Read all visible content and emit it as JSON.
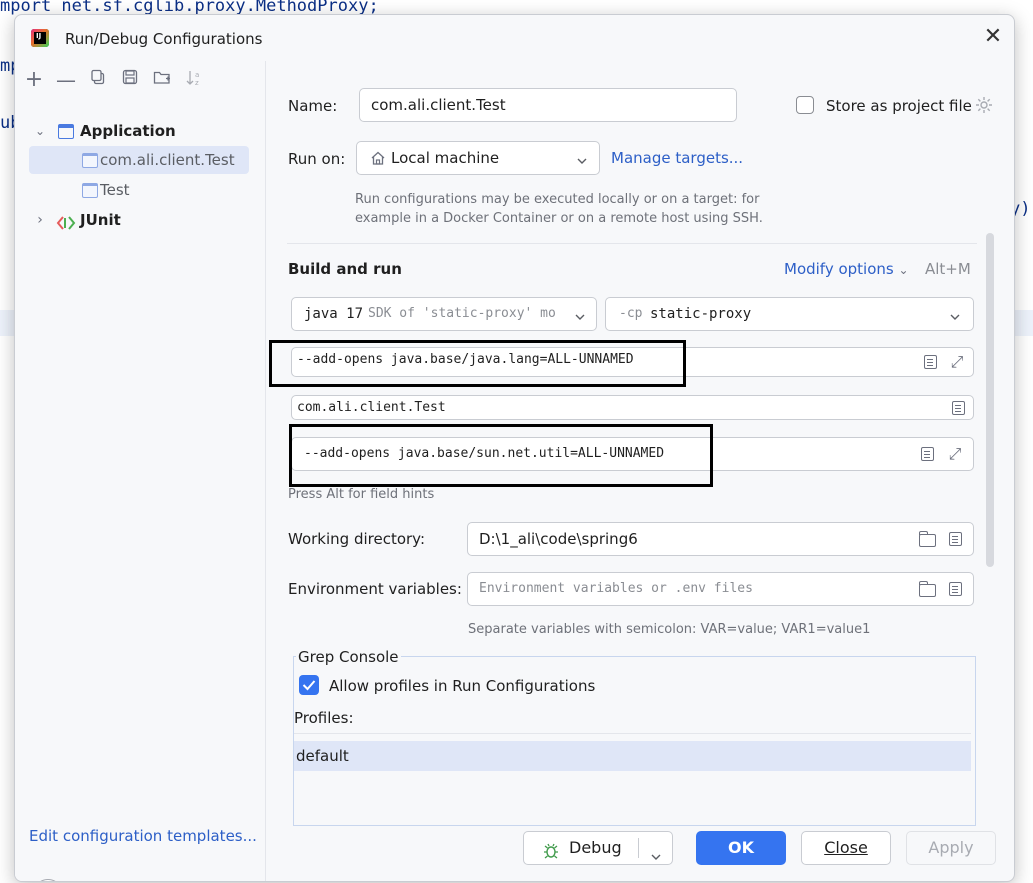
{
  "editor": {
    "line1": "mport net.sf.cglib.proxy.MethodProxy;",
    "frag2": "mp",
    "frag3": "ub",
    "frag4": "y)"
  },
  "dialog": {
    "title": "Run/Debug Configurations",
    "close_icon": "close-icon"
  },
  "tree": {
    "application_label": "Application",
    "config_selected": "com.ali.client.Test",
    "config_test": "Test",
    "junit_label": "JUnit"
  },
  "left": {
    "edit_templates": "Edit configuration templates...",
    "help": "?"
  },
  "form": {
    "name_label": "Name:",
    "name_value": "com.ali.client.Test",
    "store_label": "Store as project file",
    "store_checked": false,
    "run_on_label": "Run on:",
    "run_on_value": "Local machine",
    "manage_targets": "Manage targets...",
    "run_on_hint_1": "Run configurations may be executed locally or on a target: for",
    "run_on_hint_2": "example in a Docker Container or on a remote host using SSH.",
    "build_run_title": "Build and run",
    "modify_options": "Modify options",
    "modify_shortcut": "Alt+M",
    "sdk_main": "java 17",
    "sdk_detail": "SDK of 'static-proxy' mo",
    "cp_prefix": "-cp",
    "cp_value": "static-proxy",
    "vm_options": "--add-opens java.base/java.lang=ALL-UNNAMED",
    "main_class": "com.ali.client.Test",
    "program_args": "--add-opens java.base/sun.net.util=ALL-UNNAMED",
    "field_hint": "Press Alt for field hints",
    "workdir_label": "Working directory:",
    "workdir_value": "D:\\1_ali\\code\\spring6",
    "env_label": "Environment variables:",
    "env_placeholder": "Environment variables or .env files",
    "env_hint": "Separate variables with semicolon: VAR=value; VAR1=value1"
  },
  "grep": {
    "group_title": "Grep Console",
    "allow_label": "Allow profiles in Run Configurations",
    "allow_checked": true,
    "profiles_label": "Profiles:",
    "profile_default": "default"
  },
  "buttons": {
    "debug": "Debug",
    "ok": "OK",
    "close": "Close",
    "apply": "Apply"
  },
  "colors": {
    "accent": "#3574f0",
    "link": "#2d5fc7",
    "selection": "#dfe6f7"
  }
}
